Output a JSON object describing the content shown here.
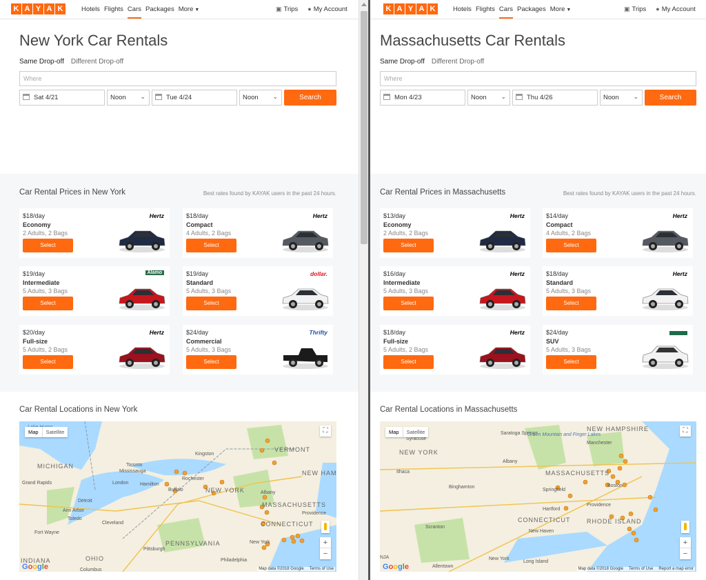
{
  "colors": {
    "accent": "#ff690f",
    "water": "#aadaff",
    "land": "#f4efe0",
    "park": "#c7e2a8"
  },
  "header": {
    "logo_letters": [
      "K",
      "A",
      "Y",
      "A",
      "K"
    ],
    "nav": [
      "Hotels",
      "Flights",
      "Cars",
      "Packages"
    ],
    "more": "More",
    "trips": "Trips",
    "account": "My Account",
    "icons": {
      "trips": "briefcase-icon",
      "account": "user-icon",
      "more": "chevron-down-icon"
    }
  },
  "left": {
    "title": "New York Car Rentals",
    "tab_same": "Same Drop-off",
    "tab_diff": "Different Drop-off",
    "where_placeholder": "Where",
    "pickup_date": "Sat 4/21",
    "pickup_time": "Noon",
    "dropoff_date": "Tue 4/24",
    "dropoff_time": "Noon",
    "search": "Search",
    "prices_title": "Car Rental Prices in New York",
    "prices_note": "Best rates found by KAYAK users in the past 24 hours.",
    "cards": [
      {
        "price": "$18/day",
        "class": "Economy",
        "capacity": "2 Adults, 2 Bags",
        "brand": "Hertz",
        "car_color": "#1f2a44"
      },
      {
        "price": "$18/day",
        "class": "Compact",
        "capacity": "4 Adults, 2 Bags",
        "brand": "Hertz",
        "car_color": "#555a60"
      },
      {
        "price": "$19/day",
        "class": "Intermediate",
        "capacity": "5 Adults, 3 Bags",
        "brand": "Alamo",
        "car_color": "#c8161d"
      },
      {
        "price": "$19/day",
        "class": "Standard",
        "capacity": "5 Adults, 3 Bags",
        "brand": "dollar.",
        "car_color": "#f2f2f2"
      },
      {
        "price": "$20/day",
        "class": "Full-size",
        "capacity": "5 Adults, 2 Bags",
        "brand": "Hertz",
        "car_color": "#9b111e"
      },
      {
        "price": "$24/day",
        "class": "Commercial",
        "capacity": "5 Adults, 3 Bags",
        "brand": "Thrifty",
        "car_color": "#1b1b1b"
      }
    ],
    "select_label": "Select",
    "locations_title": "Car Rental Locations in New York",
    "map_tabs": [
      "Map",
      "Satellite"
    ],
    "map_footer": [
      "Map data ©2018 Google",
      "Terms of Use"
    ],
    "map_labels": [
      "MICHIGAN",
      "Toronto",
      "Mississauga",
      "Kingston",
      "VERMONT",
      "NEW HAMPSHIRE",
      "Grand Rapids",
      "London",
      "Hamilton",
      "Rochester",
      "Buffalo",
      "NEW YORK",
      "Albany",
      "Detroit",
      "Ann Arbor",
      "Toledo",
      "Cleveland",
      "MASSACHUSETTS",
      "Providence",
      "CONNECTICUT",
      "Fort Wayne",
      "Pittsburgh",
      "PENNSYLVANIA",
      "New York",
      "OHIO",
      "Philadelphia",
      "Columbus",
      "Lake Huron",
      "INDIANA"
    ]
  },
  "right": {
    "title": "Massachusetts Car Rentals",
    "tab_same": "Same Drop-off",
    "tab_diff": "Different Drop-off",
    "where_placeholder": "Where",
    "pickup_date": "Mon 4/23",
    "pickup_time": "Noon",
    "dropoff_date": "Thu 4/26",
    "dropoff_time": "Noon",
    "search": "Search",
    "prices_title": "Car Rental Prices in Massachusetts",
    "prices_note": "Best rates found by KAYAK users in the past 24 hours.",
    "cards": [
      {
        "price": "$13/day",
        "class": "Economy",
        "capacity": "2 Adults, 2 Bags",
        "brand": "Hertz",
        "car_color": "#1f2a44"
      },
      {
        "price": "$14/day",
        "class": "Compact",
        "capacity": "4 Adults, 2 Bags",
        "brand": "Hertz",
        "car_color": "#555a60"
      },
      {
        "price": "$16/day",
        "class": "Intermediate",
        "capacity": "5 Adults, 3 Bags",
        "brand": "Hertz",
        "car_color": "#c8161d"
      },
      {
        "price": "$18/day",
        "class": "Standard",
        "capacity": "5 Adults, 3 Bags",
        "brand": "Hertz",
        "car_color": "#f2f2f2"
      },
      {
        "price": "$18/day",
        "class": "Full-size",
        "capacity": "5 Adults, 2 Bags",
        "brand": "Hertz",
        "car_color": "#9b111e"
      },
      {
        "price": "$24/day",
        "class": "SUV",
        "capacity": "5 Adults, 3 Bags",
        "brand": "",
        "car_color": "#f2f2f2"
      }
    ],
    "select_label": "Select",
    "locations_title": "Car Rental Locations in Massachusetts",
    "map_tabs": [
      "Map",
      "Satellite"
    ],
    "map_footer": [
      "Map data ©2018 Google",
      "Terms of Use",
      "Report a map error"
    ],
    "map_labels": [
      "NEW HAMPSHIRE",
      "Syracuse",
      "Saratoga Springs",
      "Green Mountain and Finger Lakes",
      "Manchester",
      "NEW YORK",
      "Ithaca",
      "Albany",
      "MASSACHUSETTS",
      "Binghamton",
      "Springfield",
      "Boston",
      "Hartford",
      "Providence",
      "CONNECTICUT",
      "RHODE ISLAND",
      "Scranton",
      "New Haven",
      "New York",
      "Long Island",
      "Allentown",
      "NJA"
    ]
  },
  "google_letters": [
    "G",
    "o",
    "o",
    "g",
    "l",
    "e"
  ]
}
